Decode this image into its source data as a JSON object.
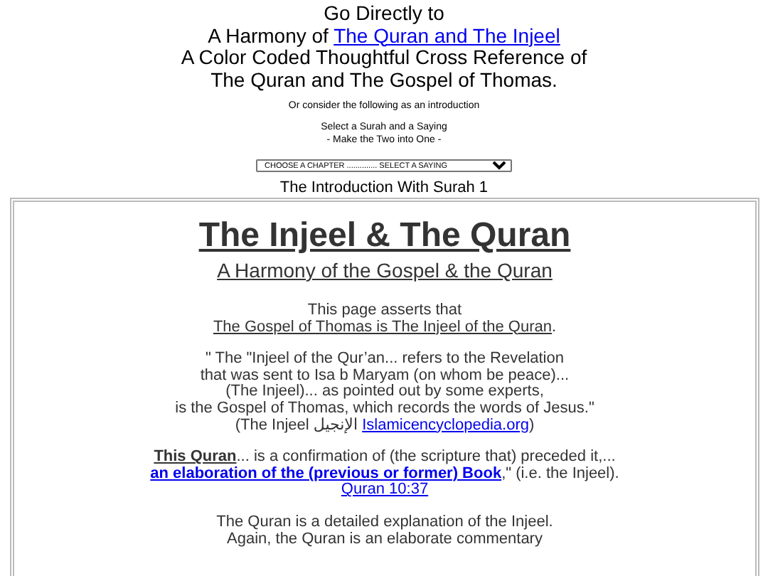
{
  "header": {
    "lines": [
      [
        {
          "kind": "plain",
          "text": "Go Directly to"
        }
      ],
      [
        {
          "kind": "plain",
          "text": "A Harmony of "
        },
        {
          "kind": "link",
          "text": "The Quran and The Injeel"
        }
      ],
      [
        {
          "kind": "plain",
          "text": "A Color Coded Thoughtful Cross Reference of"
        }
      ],
      [
        {
          "kind": "plain",
          "text": "The Quran and The Gospel of Thomas."
        }
      ]
    ]
  },
  "intro_note": "Or consider the following as an introduction",
  "select_prompt": [
    "Select a Surah and a Saying",
    "- Make the Two into One -"
  ],
  "saying_select": {
    "value": "CHOOSE A CHAPTER .............. SELECT A SAYING"
  },
  "intro_title": "The Introduction With Surah 1",
  "article": {
    "title": "The Injeel & The Quran",
    "subtitle": "A Harmony of the Gospel & the Quran",
    "paragraphs": [
      {
        "lines": [
          [
            {
              "kind": "plain",
              "text": "This page asserts that"
            }
          ],
          [
            {
              "kind": "underlined",
              "text": "The Gospel of Thomas is The Injeel of the Quran"
            },
            {
              "kind": "plain",
              "text": "."
            }
          ]
        ]
      },
      {
        "lines": [
          [
            {
              "kind": "plain",
              "text": "\" The \"Injeel of the Qur’an... refers to the Revelation"
            }
          ],
          [
            {
              "kind": "plain",
              "text": "that was sent to Isa b Maryam (on whom be peace)..."
            }
          ],
          [
            {
              "kind": "plain",
              "text": "(The Injeel)... as pointed out by some experts,"
            }
          ],
          [
            {
              "kind": "plain",
              "text": "is the Gospel of Thomas, which records the words of Jesus.\""
            }
          ],
          [
            {
              "kind": "plain",
              "text": "(The Injeel الإنجيل "
            },
            {
              "kind": "link",
              "text": "Islamicencyclopedia.org"
            },
            {
              "kind": "plain",
              "text": ")"
            }
          ]
        ]
      },
      {
        "lines": [
          [
            {
              "kind": "bold_underlined",
              "text": "This Quran"
            },
            {
              "kind": "plain",
              "text": "... is a confirmation of (the scripture that) preceded it,..."
            }
          ],
          [
            {
              "kind": "bold_link",
              "text": "an elaboration of the (previous or former) Book"
            },
            {
              "kind": "plain",
              "text": ",\" (i.e. the Injeel)."
            }
          ],
          [
            {
              "kind": "link",
              "text": "Quran 10:37"
            }
          ]
        ]
      },
      {
        "lines": [
          [
            {
              "kind": "plain",
              "text": "The Quran is a detailed explanation of the Injeel."
            }
          ],
          [
            {
              "kind": "plain",
              "text": "Again, the Quran is an elaborate commentary"
            }
          ]
        ]
      }
    ]
  }
}
